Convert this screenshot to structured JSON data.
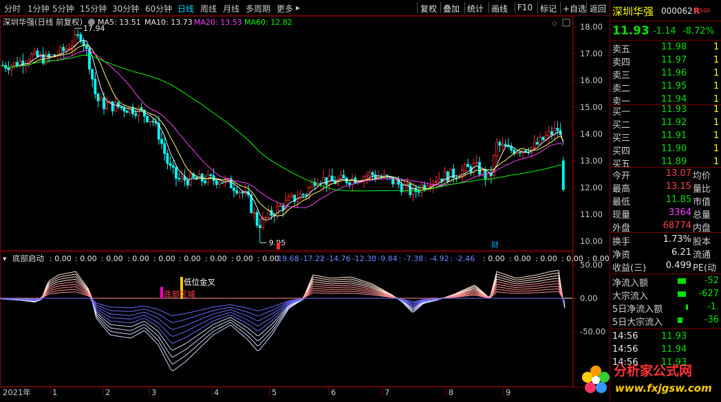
{
  "toolbar": {
    "periods": [
      "分时",
      "1分钟",
      "5分钟",
      "15分钟",
      "30分钟",
      "60分钟",
      "日线",
      "周线",
      "月线",
      "多周期",
      "更多"
    ],
    "active_period": "日线",
    "right_buttons": [
      "复权",
      "叠加",
      "统计",
      "画线",
      "F10",
      "标记",
      "+自选",
      "返回"
    ]
  },
  "stock": {
    "name": "深圳华强",
    "code": "000062",
    "tag": "R",
    "tag_sub": "500",
    "price": "11.93",
    "change": "-1.14",
    "change_pct": "-8.72%"
  },
  "main_chart": {
    "title": "深圳华强(日线 前复权)",
    "indicators": [
      {
        "label": "MA5: 13.51",
        "color": "#e8e8e8"
      },
      {
        "label": "MA10: 13.73",
        "color": "#e8e8e8"
      },
      {
        "label": "MA20: 13.53",
        "color": "#ff40ff"
      },
      {
        "label": "MA60: 12.82",
        "color": "#00ff00"
      }
    ],
    "y_ticks": [
      "18.00",
      "17.00",
      "16.00",
      "15.00",
      "14.00",
      "13.00",
      "12.00",
      "11.00",
      "10.00"
    ],
    "high_label": "17.94",
    "low_label": "9.95",
    "event_mark": "财"
  },
  "sub_chart": {
    "title": "底部启动",
    "values": [
      ": 0.00",
      ": 0.00",
      ": 0.00",
      ": 0.00",
      ": 0.00",
      ": 0.00",
      ": 0.00",
      ": 0.00",
      ": 0.00",
      ": -19.68",
      ": -17.22",
      ": -14.76",
      ": -12.30",
      ": -9.84",
      ": -7.38",
      ": -4.92",
      ": -2.46",
      ": 0.00",
      ": 0.00",
      ": 0.00",
      ": 0.00",
      ": 0.00"
    ],
    "y_ticks": [
      "50.00",
      "0.00",
      "-50.00"
    ],
    "annotation_low": "低位金叉",
    "annotation_zone": "底部区域"
  },
  "x_axis": [
    "2021年",
    "1",
    "2",
    "3",
    "4",
    "5",
    "6",
    "7",
    "8",
    "9"
  ],
  "order_book": {
    "sell": [
      {
        "label": "卖五",
        "price": "11.98",
        "vol": "1"
      },
      {
        "label": "卖四",
        "price": "11.97",
        "vol": "1"
      },
      {
        "label": "卖三",
        "price": "11.96",
        "vol": "1"
      },
      {
        "label": "卖二",
        "price": "11.95",
        "vol": "1"
      },
      {
        "label": "卖一",
        "price": "11.94",
        "vol": "1"
      }
    ],
    "buy": [
      {
        "label": "买一",
        "price": "11.93",
        "vol": "1"
      },
      {
        "label": "买二",
        "price": "11.92",
        "vol": "1"
      },
      {
        "label": "买三",
        "price": "11.91",
        "vol": "1"
      },
      {
        "label": "买四",
        "price": "11.90",
        "vol": "1"
      },
      {
        "label": "买五",
        "price": "11.89",
        "vol": "1"
      }
    ]
  },
  "quote": [
    {
      "l": "今开",
      "v": "13.07",
      "vc": "#ff4040",
      "r": "均价"
    },
    {
      "l": "最高",
      "v": "13.15",
      "vc": "#ff4040",
      "r": "量比"
    },
    {
      "l": "最低",
      "v": "11.85",
      "vc": "#00e000",
      "r": "市值"
    },
    {
      "l": "现量",
      "v": "3364",
      "vc": "#ff40ff",
      "r": "总量"
    },
    {
      "l": "外盘",
      "v": "68774",
      "vc": "#ff4040",
      "r": "内盘"
    }
  ],
  "fundamental": [
    {
      "l": "换手",
      "v": "1.73%",
      "r": "股本"
    },
    {
      "l": "净资",
      "v": "6.21",
      "r": "流通"
    },
    {
      "l": "收益(三)",
      "v": "0.499",
      "r": "PE(动"
    }
  ],
  "flow": [
    {
      "l": "净流入额",
      "v": "-52",
      "bar": "#00e000"
    },
    {
      "l": "大宗流入",
      "v": "-627",
      "bar": "#00e000"
    },
    {
      "l": "5日净流入额",
      "v": "-1.",
      "bar": "#00e000"
    },
    {
      "l": "5日大宗流入",
      "v": "-36",
      "bar": "#00e000"
    }
  ],
  "ticks": [
    {
      "t": "14:56",
      "p": "11.93"
    },
    {
      "t": "14:56",
      "p": "11.94"
    },
    {
      "t": "14:56",
      "p": "11.93"
    }
  ],
  "logo": {
    "cn": "分析家公式网",
    "url": "www.fxjgsw.com"
  }
}
